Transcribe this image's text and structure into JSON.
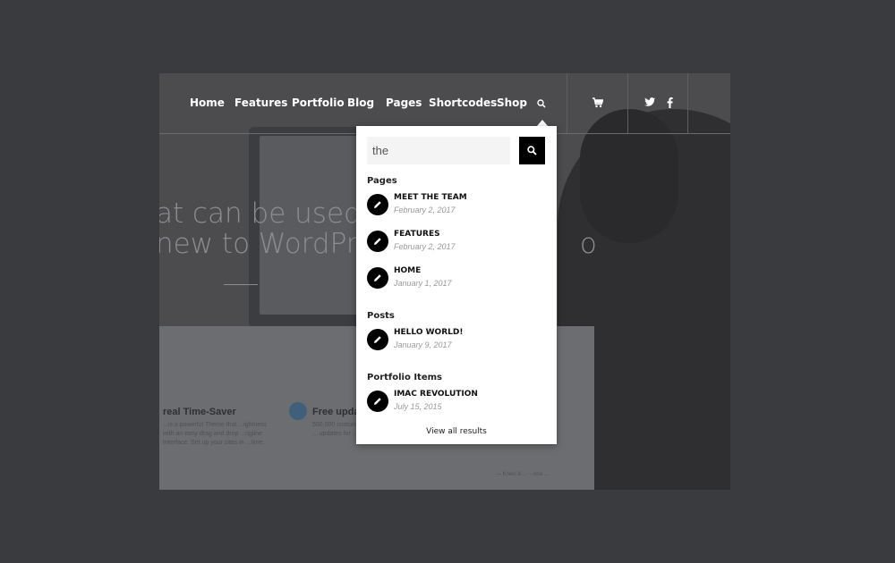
{
  "nav": {
    "items": [
      "Home",
      "Features",
      "Portfolio",
      "Blog",
      "Pages",
      "Shortcodes",
      "Shop"
    ],
    "search_icon": "search-icon",
    "cart_icon": "cart-icon",
    "social": [
      "twitter-icon",
      "facebook-icon"
    ]
  },
  "hero": {
    "line1": "at can be used b",
    "line2": "new to WordPre",
    "line2_tail": "o"
  },
  "features": [
    {
      "title": "real Time-Saver",
      "text": "...is a powerful Theme that ...ightness with an easy drag and drop ...ngline Interface. Set up your sites in ...time."
    },
    {
      "title": "Free upda",
      "text": "500,000 customers ... We offer lifetime ... updates for ..."
    }
  ],
  "footer_note": "— Kriesi & ... ~ Ana ...",
  "search": {
    "query": "the",
    "placeholder": "",
    "sections": [
      {
        "title": "Pages",
        "results": [
          {
            "title": "MEET THE TEAM",
            "date": "February 2, 2017"
          },
          {
            "title": "FEATURES",
            "date": "February 2, 2017"
          },
          {
            "title": "HOME",
            "date": "January 1, 2017"
          }
        ]
      },
      {
        "title": "Posts",
        "results": [
          {
            "title": "HELLO WORLD!",
            "date": "January 9, 2017"
          }
        ]
      },
      {
        "title": "Portfolio Items",
        "results": [
          {
            "title": "IMAC REVOLUTION",
            "date": "July 15, 2015"
          }
        ]
      }
    ],
    "view_all": "View all results"
  },
  "colors": {
    "page_bg": "#3a3b3e",
    "dropdown_bg": "#ffffff",
    "accent": "#000000"
  }
}
